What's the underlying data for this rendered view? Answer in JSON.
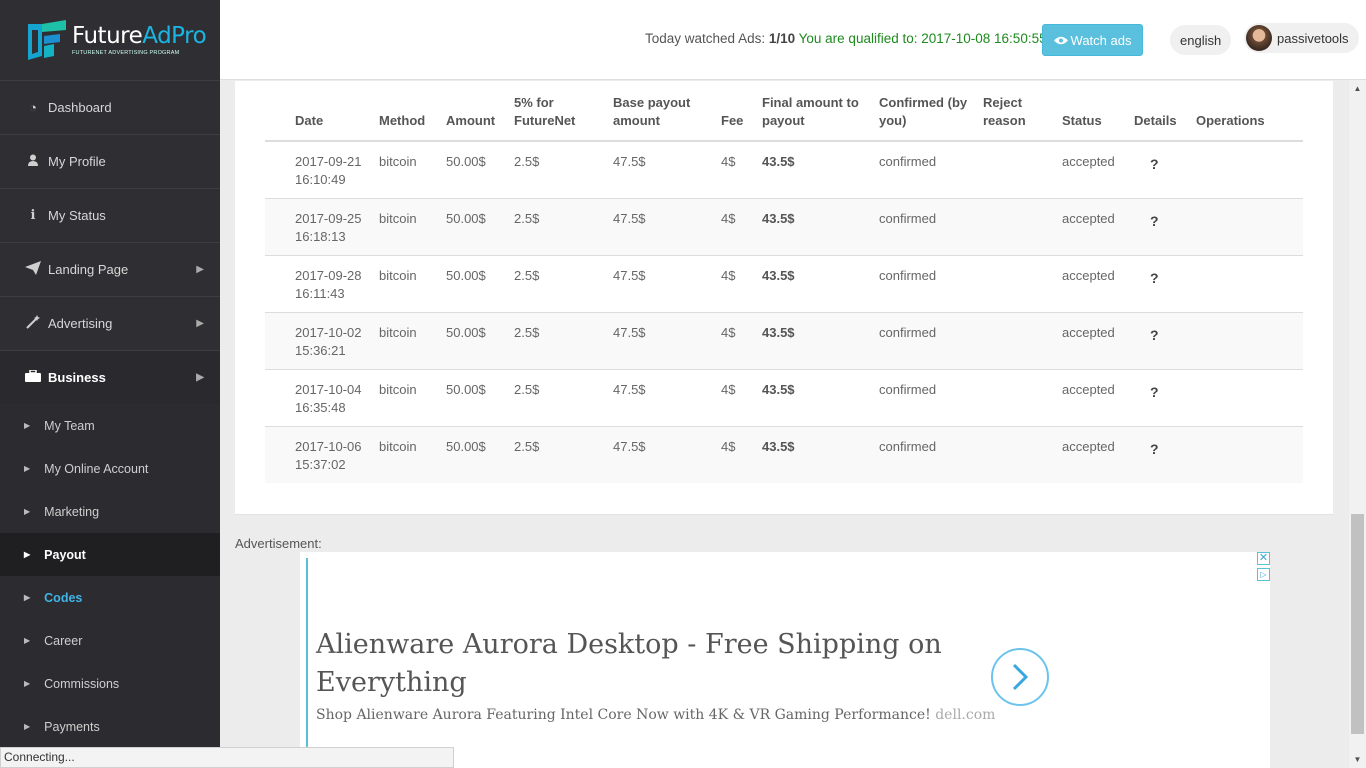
{
  "brand": {
    "title_main": "Future",
    "title_accent": "AdPro",
    "subtitle": "FUTURENET ADVERTISING PROGRAM"
  },
  "sidebar": {
    "items": [
      {
        "label": "Dashboard",
        "icon": "dashboard-icon"
      },
      {
        "label": "My Profile",
        "icon": "user-icon"
      },
      {
        "label": "My Status",
        "icon": "info-icon"
      },
      {
        "label": "Landing Page",
        "icon": "paper-plane-icon"
      },
      {
        "label": "Advertising",
        "icon": "magic-wand-icon"
      },
      {
        "label": "Business",
        "icon": "briefcase-icon"
      }
    ],
    "sub_items": [
      {
        "label": "My Team"
      },
      {
        "label": "My Online Account"
      },
      {
        "label": "Marketing"
      },
      {
        "label": "Payout"
      },
      {
        "label": "Codes"
      },
      {
        "label": "Career"
      },
      {
        "label": "Commissions"
      },
      {
        "label": "Payments"
      }
    ]
  },
  "header": {
    "watched_label": "Today watched Ads:",
    "watched_value": "1/10",
    "qualified_text": "You are qualified to: 2017-10-08 16:50:55",
    "watch_button": "Watch ads",
    "language": "english",
    "username": "passivetools"
  },
  "table": {
    "headers": [
      "Date",
      "Method",
      "Amount",
      "5% for FutureNet",
      "Base payout amount",
      "Fee",
      "Final amount to payout",
      "Confirmed (by you)",
      "Reject reason",
      "Status",
      "Details",
      "Operations"
    ],
    "rows": [
      {
        "date": "2017-09-21",
        "time": "16:10:49",
        "method": "bitcoin",
        "amount": "50.00$",
        "pct": "2.5$",
        "base": "47.5$",
        "fee": "4$",
        "final": "43.5$",
        "confirmed": "confirmed",
        "reject": "",
        "status": "accepted",
        "details": "?"
      },
      {
        "date": "2017-09-25",
        "time": "16:18:13",
        "method": "bitcoin",
        "amount": "50.00$",
        "pct": "2.5$",
        "base": "47.5$",
        "fee": "4$",
        "final": "43.5$",
        "confirmed": "confirmed",
        "reject": "",
        "status": "accepted",
        "details": "?"
      },
      {
        "date": "2017-09-28",
        "time": "16:11:43",
        "method": "bitcoin",
        "amount": "50.00$",
        "pct": "2.5$",
        "base": "47.5$",
        "fee": "4$",
        "final": "43.5$",
        "confirmed": "confirmed",
        "reject": "",
        "status": "accepted",
        "details": "?"
      },
      {
        "date": "2017-10-02",
        "time": "15:36:21",
        "method": "bitcoin",
        "amount": "50.00$",
        "pct": "2.5$",
        "base": "47.5$",
        "fee": "4$",
        "final": "43.5$",
        "confirmed": "confirmed",
        "reject": "",
        "status": "accepted",
        "details": "?"
      },
      {
        "date": "2017-10-04",
        "time": "16:35:48",
        "method": "bitcoin",
        "amount": "50.00$",
        "pct": "2.5$",
        "base": "47.5$",
        "fee": "4$",
        "final": "43.5$",
        "confirmed": "confirmed",
        "reject": "",
        "status": "accepted",
        "details": "?"
      },
      {
        "date": "2017-10-06",
        "time": "15:37:02",
        "method": "bitcoin",
        "amount": "50.00$",
        "pct": "2.5$",
        "base": "47.5$",
        "fee": "4$",
        "final": "43.5$",
        "confirmed": "confirmed",
        "reject": "",
        "status": "accepted",
        "details": "?"
      }
    ]
  },
  "ad": {
    "label": "Advertisement:",
    "title": "Alienware Aurora Desktop - Free Shipping on Everything",
    "description": "Shop Alienware Aurora Featuring Intel Core Now with 4K & VR Gaming Performance!",
    "domain": "dell.com"
  },
  "status_bar": "Connecting...",
  "colors": {
    "sidebar_bg": "#2f2f33",
    "accent": "#5bc0de",
    "qualified_green": "#1e8a1e",
    "codes_link": "#41b3e6"
  }
}
